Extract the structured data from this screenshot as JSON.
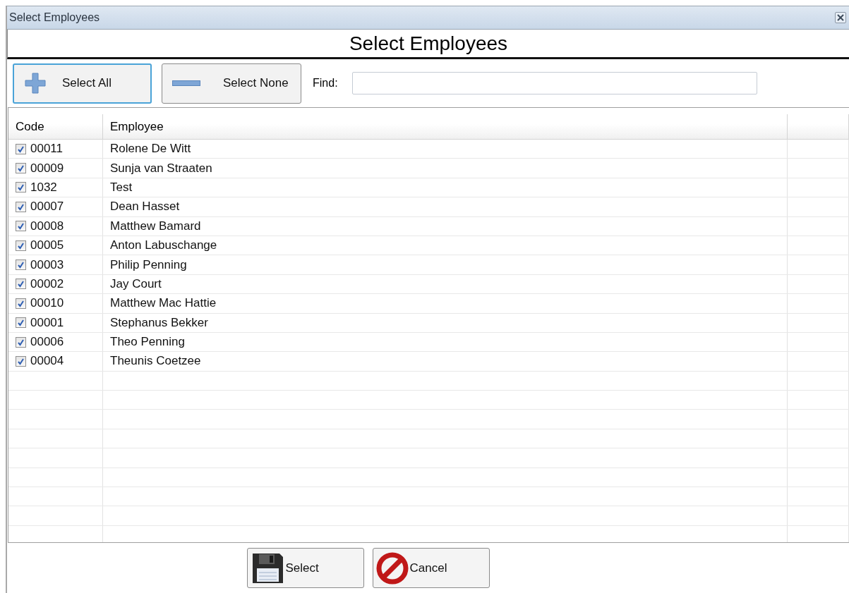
{
  "window": {
    "title": "Select Employees"
  },
  "header": {
    "title": "Select Employees"
  },
  "toolbar": {
    "select_all": "Select All",
    "select_none": "Select None",
    "find_label": "Find:"
  },
  "table": {
    "columns": [
      "Code",
      "Employee"
    ],
    "rows": [
      {
        "code": "00011",
        "employee": "Rolene De Witt",
        "checked": true
      },
      {
        "code": "00009",
        "employee": "Sunja van Straaten",
        "checked": true
      },
      {
        "code": "1032",
        "employee": "Test",
        "checked": true
      },
      {
        "code": "00007",
        "employee": "Dean Hasset",
        "checked": true
      },
      {
        "code": "00008",
        "employee": "Matthew Bamard",
        "checked": true
      },
      {
        "code": "00005",
        "employee": "Anton Labuschange",
        "checked": true
      },
      {
        "code": "00003",
        "employee": "Philip Penning",
        "checked": true
      },
      {
        "code": "00002",
        "employee": "Jay Court",
        "checked": true
      },
      {
        "code": "00010",
        "employee": "Matthew Mac Hattie",
        "checked": true
      },
      {
        "code": "00001",
        "employee": "Stephanus Bekker",
        "checked": true
      },
      {
        "code": "00006",
        "employee": "Theo Penning",
        "checked": true
      },
      {
        "code": "00004",
        "employee": "Theunis Coetzee",
        "checked": true
      }
    ]
  },
  "buttons": {
    "select": "Select",
    "cancel": "Cancel"
  }
}
